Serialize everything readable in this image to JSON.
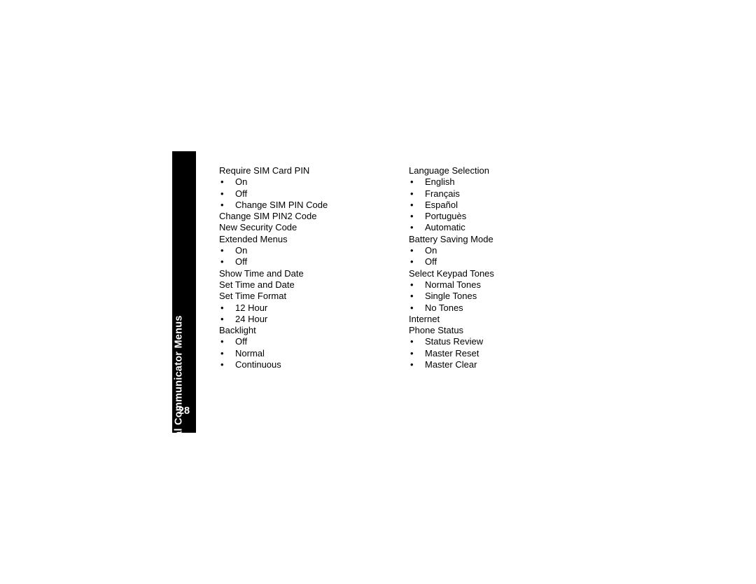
{
  "page": {
    "number": "28",
    "side_tab_title": "Personal Communicator Menus",
    "bullet_glyph": "•"
  },
  "columns": [
    {
      "name": "column-left",
      "items": [
        {
          "level": 0,
          "label": "Require SIM Card PIN"
        },
        {
          "level": 1,
          "label": "On"
        },
        {
          "level": 1,
          "label": "Off"
        },
        {
          "level": 1,
          "label": "Change SIM PIN Code"
        },
        {
          "level": 0,
          "label": "Change SIM PIN2 Code"
        },
        {
          "level": 0,
          "label": "New Security Code"
        },
        {
          "level": 0,
          "label": "Extended Menus"
        },
        {
          "level": 1,
          "label": "On"
        },
        {
          "level": 1,
          "label": "Off"
        },
        {
          "level": 0,
          "label": "Show Time and Date"
        },
        {
          "level": 0,
          "label": "Set Time and Date"
        },
        {
          "level": 0,
          "label": "Set Time Format"
        },
        {
          "level": 1,
          "label": "12 Hour"
        },
        {
          "level": 1,
          "label": "24 Hour"
        },
        {
          "level": 0,
          "label": "Backlight"
        },
        {
          "level": 1,
          "label": "Off"
        },
        {
          "level": 1,
          "label": "Normal"
        },
        {
          "level": 1,
          "label": "Continuous"
        }
      ]
    },
    {
      "name": "column-right",
      "items": [
        {
          "level": 0,
          "label": "Language Selection"
        },
        {
          "level": 1,
          "label": "English"
        },
        {
          "level": 1,
          "label": "Français"
        },
        {
          "level": 1,
          "label": "Español"
        },
        {
          "level": 1,
          "label": "Portuguès"
        },
        {
          "level": 1,
          "label": "Automatic"
        },
        {
          "level": 0,
          "label": "Battery Saving Mode"
        },
        {
          "level": 1,
          "label": "On"
        },
        {
          "level": 1,
          "label": "Off"
        },
        {
          "level": 0,
          "label": "Select Keypad Tones"
        },
        {
          "level": 1,
          "label": "Normal Tones"
        },
        {
          "level": 1,
          "label": "Single Tones"
        },
        {
          "level": 1,
          "label": "No Tones"
        },
        {
          "level": 0,
          "label": "Internet"
        },
        {
          "level": 0,
          "label": "Phone Status"
        },
        {
          "level": 1,
          "label": "Status Review"
        },
        {
          "level": 1,
          "label": "Master Reset"
        },
        {
          "level": 1,
          "label": "Master Clear"
        }
      ]
    }
  ],
  "colors": {
    "page_background": "#ffffff",
    "text": "#000000",
    "side_tab_background": "#000000",
    "side_tab_text": "#ffffff"
  }
}
